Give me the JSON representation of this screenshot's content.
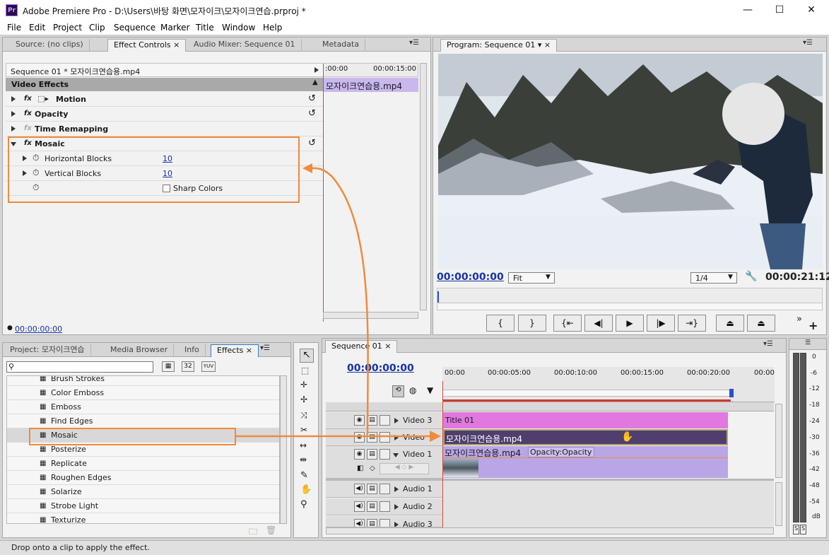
{
  "window": {
    "title": "Adobe Premiere Pro - D:\\Users\\바탕 화면\\모자이크\\모자이크연습.prproj *",
    "app_icon": "Pr"
  },
  "menu": [
    "File",
    "Edit",
    "Project",
    "Clip",
    "Sequence",
    "Marker",
    "Title",
    "Window",
    "Help"
  ],
  "source_panel": {
    "tabs": [
      "Source: (no clips)",
      "Effect Controls",
      "Audio Mixer: Sequence 01",
      "Metadata"
    ],
    "sequence_label": "Sequence 01 * 모자이크연습용.mp4",
    "ruler_start": ":00:00",
    "ruler_end": "00:00:15:00",
    "clip_label": "모자이크연습용.mp4",
    "section": "Video Effects",
    "effects": [
      {
        "name": "Motion"
      },
      {
        "name": "Opacity"
      },
      {
        "name": "Time Remapping"
      },
      {
        "name": "Mosaic"
      }
    ],
    "mosaic_params": [
      {
        "name": "Horizontal Blocks",
        "value": "10"
      },
      {
        "name": "Vertical Blocks",
        "value": "10"
      }
    ],
    "sharp_colors_label": "Sharp Colors",
    "timecode": "00:00:00:00"
  },
  "program_panel": {
    "tab": "Program: Sequence 01",
    "timecode": "00:00:00:00",
    "fit": "Fit",
    "resolution": "1/4",
    "duration": "00:00:21:12"
  },
  "project_panel": {
    "tabs": [
      "Project: 모자이크연습",
      "Media Browser",
      "Info",
      "Effects"
    ],
    "search_placeholder": "",
    "filter_labels": [
      "32",
      "YUV"
    ],
    "items": [
      "Brush Strokes",
      "Color Emboss",
      "Emboss",
      "Find Edges",
      "Mosaic",
      "Posterize",
      "Replicate",
      "Roughen Edges",
      "Solarize",
      "Strobe Light",
      "Texturize"
    ],
    "selected_item": "Mosaic"
  },
  "timeline": {
    "tab": "Sequence 01",
    "timecode": "00:00:00:00",
    "ruler": [
      "00:00",
      "00:00:05:00",
      "00:00:10:00",
      "00:00:15:00",
      "00:00:20:00",
      "00:00"
    ],
    "tracks": {
      "video3": "Video 3",
      "video2": "Video",
      "video1": "Video 1",
      "audio1": "Audio 1",
      "audio2": "Audio 2",
      "audio3": "Audio 3"
    },
    "clips": {
      "title": "Title 01",
      "video2_clip": "모자이크연습용.mp4",
      "video1_clip": "모자이크연습용.mp4",
      "video1_opacity": "Opacity:Opacity"
    }
  },
  "vu_meter": {
    "ticks": [
      "0",
      "-6",
      "-12",
      "-18",
      "-24",
      "-30",
      "-36",
      "-42",
      "-48",
      "-54",
      "dB"
    ],
    "solo": [
      "S",
      "S"
    ]
  },
  "status_bar": "Drop onto a clip to apply the effect.",
  "colors": {
    "accent_orange": "#f08a3c",
    "title_clip": "#e078e0",
    "video_clip": "#b9a6e6",
    "selected_clip": "#4e3f6e",
    "timecode_blue": "#1633a6"
  }
}
